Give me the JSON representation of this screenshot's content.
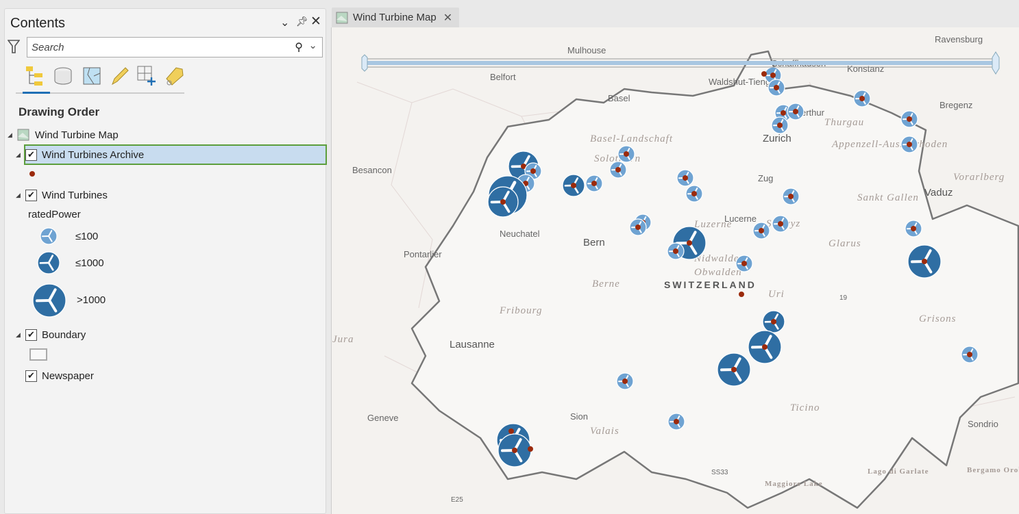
{
  "contents": {
    "title": "Contents",
    "search_placeholder": "Search",
    "section": "Drawing Order",
    "map_item": "Wind Turbine Map",
    "layers": [
      {
        "label": "Wind Turbines Archive",
        "checked": true,
        "selected": true
      },
      {
        "label": "Wind Turbines",
        "checked": true,
        "field": "ratedPower",
        "classes": [
          {
            "label": "≤100"
          },
          {
            "label": "≤1000"
          },
          {
            "label": ">1000"
          }
        ]
      },
      {
        "label": "Boundary",
        "checked": true
      },
      {
        "label": "Newspaper",
        "checked": true
      }
    ],
    "tools": [
      "list-by-drawing-order",
      "list-by-source",
      "list-by-selection",
      "list-by-editing",
      "list-by-snapping",
      "list-by-labeling"
    ]
  },
  "map": {
    "tab_label": "Wind Turbine Map",
    "colors": {
      "turbine": "#2f6ea3",
      "turbine_light": "#6fa3d2",
      "archive_dot": "#9b2a0c",
      "selection": "#5c9e3c"
    },
    "places": [
      "Mulhouse",
      "Belfort",
      "Basel",
      "Waldshut-Tiengen",
      "Schaffhausen",
      "Konstanz",
      "Ravensburg",
      "Bregenz",
      "Winterthur",
      "Zurich",
      "Besancon",
      "Vaduz",
      "Zug",
      "Lucerne",
      "Neuchatel",
      "Pontarlier",
      "Bern",
      "Lausanne",
      "Sion",
      "Sondrio",
      "Geneve"
    ],
    "regions": [
      "Thurgau",
      "Appenzell-Ausserrhoden",
      "Basel-Landschaft",
      "Solothurn",
      "Vorarlberg",
      "Sankt Gallen",
      "Schwyz",
      "Luzerne",
      "Nidwalden",
      "Obwalden",
      "Berne",
      "Glarus",
      "Uri",
      "Fribourg",
      "Grisons",
      "Valais",
      "Ticino",
      "Lago di Garlate",
      "Bergamo Orobie Park",
      "Maggiore Lake",
      "Jura"
    ],
    "country": "SWITZERLAND",
    "roads": [
      "19",
      "SS33",
      "E25"
    ]
  }
}
